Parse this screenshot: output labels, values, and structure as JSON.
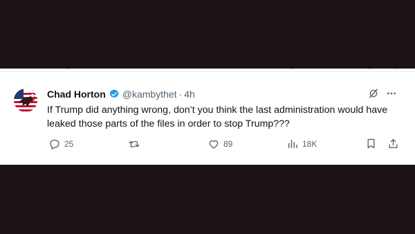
{
  "tweet": {
    "author_name": "Chad Horton",
    "handle": "@kambythet",
    "separator": "·",
    "time": "4h",
    "text": "If Trump did anything wrong, don’t you think the last administration would have leaked those parts of the files in order to stop Trump???",
    "verified": true,
    "avatar_icon": "eagle-flag-avatar"
  },
  "actions": {
    "replies": "25",
    "retweets": "",
    "likes": "89",
    "views": "18K"
  },
  "colors": {
    "text": "#0f1419",
    "secondary": "#536471",
    "verified": "#1d9bf0",
    "backdrop": "#1a1214"
  }
}
